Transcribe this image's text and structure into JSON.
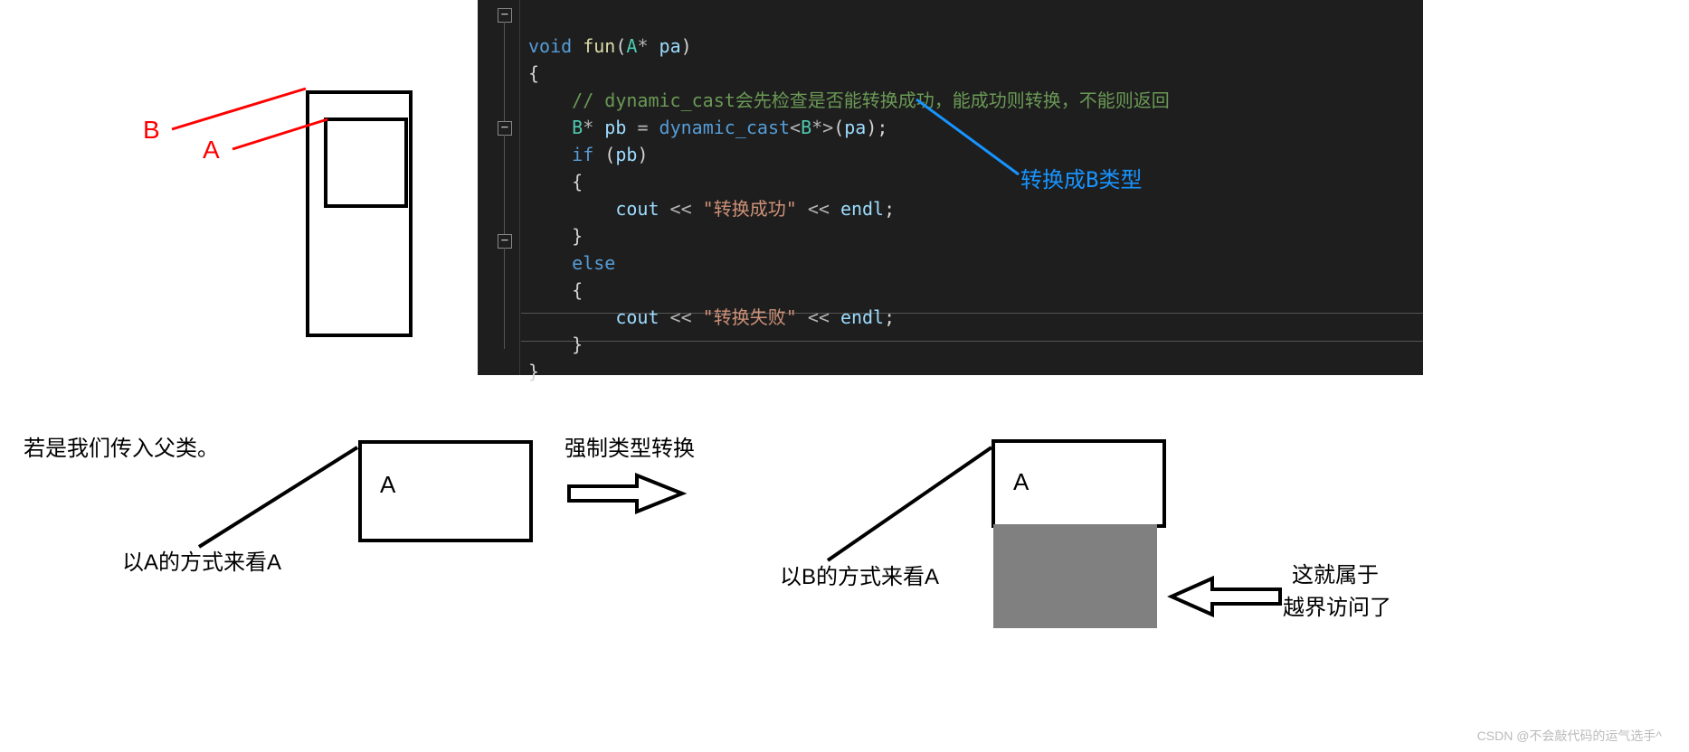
{
  "upper_diagram": {
    "label_B": "B",
    "label_A": "A"
  },
  "code": {
    "sig_void": "void",
    "sig_fun": " fun",
    "sig_open": "(",
    "sig_A": "A",
    "sig_star": "*",
    "sig_pa": " pa",
    "sig_close": ")",
    "brace_open": "{",
    "brace_close": "}",
    "comment": "// dynamic_cast会先检查是否能转换成功，能成功则转换，不能则返回",
    "decl_B": "B",
    "decl_star": "*",
    "decl_pb": " pb ",
    "decl_eq": "= ",
    "decl_dyn": "dynamic_cast",
    "decl_lt": "<",
    "decl_B2": "B",
    "decl_star2": "*",
    "decl_gt": ">",
    "decl_open": "(",
    "decl_arg": "pa",
    "decl_close": ");",
    "if_kw": "if",
    "if_open": " (",
    "if_pb": "pb",
    "if_close": ")",
    "cout": "cout ",
    "lshift": "<< ",
    "str_ok": "\"转换成功\"",
    "str_fail": "\"转换失败\"",
    "endl": "endl",
    "semi": ";",
    "else_kw": "else",
    "collapse": "−"
  },
  "annotation": "转换成B类型",
  "lower_text": {
    "intro": "若是我们传入父类。",
    "view_A": "以A的方式来看A",
    "label_A": "A",
    "cast": "强制类型转换",
    "view_B": "以B的方式来看A",
    "warn1": "这就属于",
    "warn2": "越界访问了"
  },
  "watermark": "CSDN @不会敲代码的运气选手^"
}
